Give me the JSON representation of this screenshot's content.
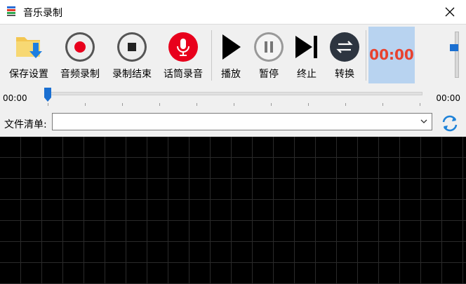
{
  "window": {
    "title": "音乐录制"
  },
  "toolbar": {
    "buttons": [
      {
        "id": "save",
        "label": "保存设置",
        "icon": "folder-save-icon"
      },
      {
        "id": "record",
        "label": "音频录制",
        "icon": "record-icon"
      },
      {
        "id": "stop",
        "label": "录制结束",
        "icon": "stop-icon"
      },
      {
        "id": "mic",
        "label": "话筒录音",
        "icon": "microphone-icon"
      },
      {
        "id": "play",
        "label": "播放",
        "icon": "play-icon"
      },
      {
        "id": "pause",
        "label": "暂停",
        "icon": "pause-icon"
      },
      {
        "id": "end",
        "label": "终止",
        "icon": "skip-end-icon"
      },
      {
        "id": "convert",
        "label": "转换",
        "icon": "convert-icon"
      }
    ],
    "time": "00:00",
    "volume_level": 0.85
  },
  "seek": {
    "current": "00:00",
    "total": "00:00",
    "progress": 0
  },
  "file_list": {
    "label": "文件清单:",
    "value": ""
  },
  "colors": {
    "accent": "#1a6fd1",
    "record_red": "#e8001c",
    "time_bg": "#b8d3f0",
    "time_text": "#e8422f"
  }
}
